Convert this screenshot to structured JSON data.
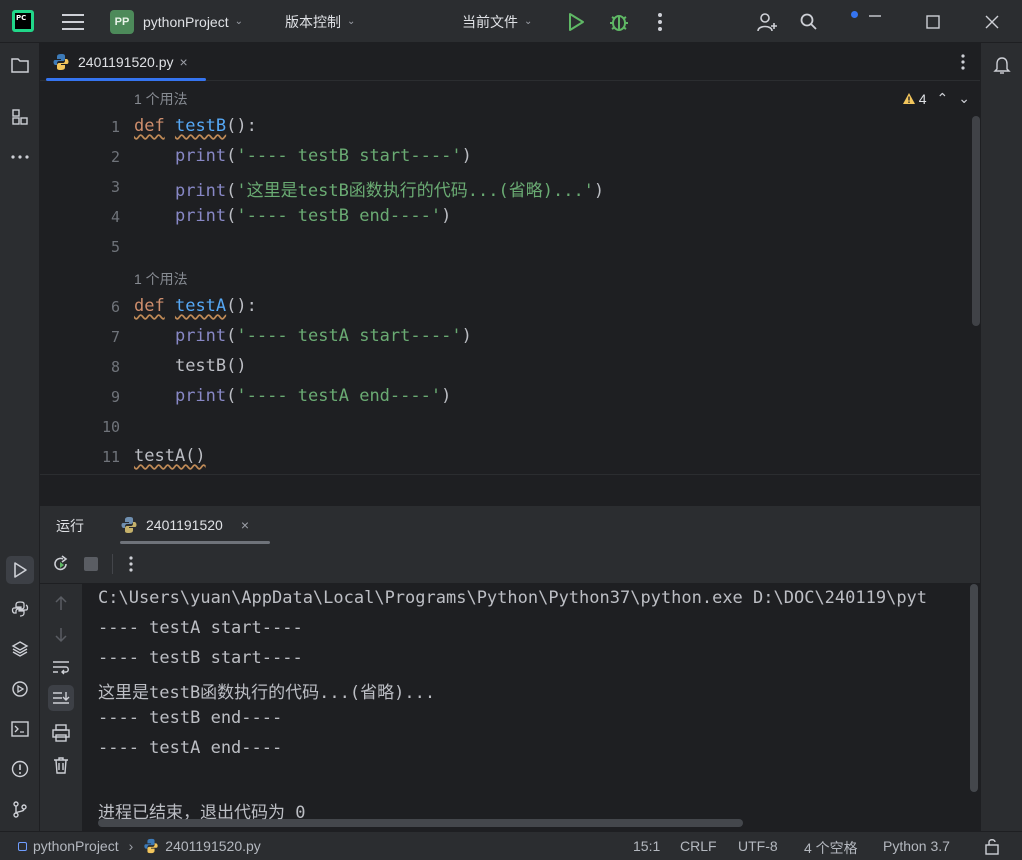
{
  "titlebar": {
    "logo_text": "PC",
    "project_badge": "PP",
    "project_name": "pythonProject",
    "vcs_label": "版本控制",
    "run_config": "当前文件"
  },
  "editor": {
    "tab_label": "2401191520.py",
    "warnings_count": "4",
    "usage_hint_1": "1 个用法",
    "usage_hint_2": "1 个用法",
    "lines": [
      {
        "n": "1"
      },
      {
        "n": "2"
      },
      {
        "n": "3"
      },
      {
        "n": "4"
      },
      {
        "n": "5"
      },
      {
        "n": "6"
      },
      {
        "n": "7"
      },
      {
        "n": "8"
      },
      {
        "n": "9"
      },
      {
        "n": "10"
      },
      {
        "n": "11"
      }
    ],
    "code": {
      "def": "def",
      "testB_name": "testB",
      "testA_name": "testA",
      "sig_tail": "():",
      "print": "print",
      "open_paren": "(",
      "close_paren": ")",
      "s_b_start": "'---- testB start----'",
      "s_b_body": "'这里是testB函数执行的代码...(省略)...'",
      "s_b_end": "'---- testB end----'",
      "s_a_start": "'---- testA start----'",
      "call_b": "testB()",
      "s_a_end": "'---- testA end----'",
      "call_a": "testA()"
    }
  },
  "run_panel": {
    "title": "运行",
    "tab_label": "2401191520",
    "output": [
      "C:\\Users\\yuan\\AppData\\Local\\Programs\\Python\\Python37\\python.exe D:\\DOC\\240119\\pyt",
      "---- testA start----",
      "---- testB start----",
      "这里是testB函数执行的代码...(省略)...",
      "---- testB end----",
      "---- testA end----",
      "",
      "进程已结束，退出代码为 0"
    ]
  },
  "statusbar": {
    "project": "pythonProject",
    "file": "2401191520.py",
    "position": "15:1",
    "line_sep": "CRLF",
    "encoding": "UTF-8",
    "indent": "4 个空格",
    "interpreter": "Python 3.7"
  },
  "colors": {
    "accent": "#3574f0",
    "run_green": "#5fb865",
    "keyword": "#cf8e6d",
    "function": "#56a8f5",
    "string": "#6aab73",
    "builtin": "#8888c6",
    "warning": "#f2c55c"
  },
  "icons": [
    "menu-icon",
    "run-icon",
    "debug-icon",
    "more-icon",
    "add-user-icon",
    "search-icon",
    "minimize-icon",
    "maximize-icon",
    "close-icon",
    "folder-icon",
    "structure-icon",
    "python-icon",
    "rerun-icon",
    "stop-icon",
    "up-icon",
    "down-icon",
    "wrap-icon",
    "scroll-end-icon",
    "print-icon",
    "trash-icon",
    "bell-icon",
    "lock-icon",
    "terminal-icon",
    "problems-icon",
    "git-icon",
    "layers-icon",
    "services-icon",
    "console-icon"
  ]
}
